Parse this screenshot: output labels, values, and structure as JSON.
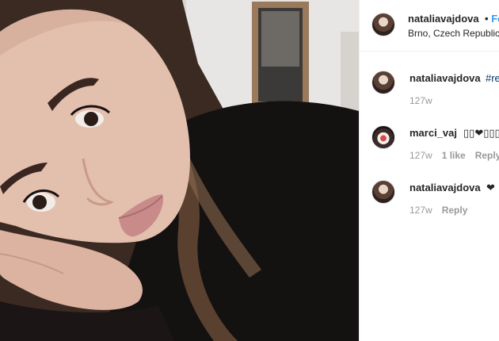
{
  "header": {
    "username": "nataliavajdova",
    "separator": "•",
    "follow_label": "Fo",
    "location": "Brno, Czech Republic"
  },
  "comments": [
    {
      "username": "nataliavajdova",
      "text": "#re",
      "time": "127w",
      "likes": "",
      "reply": ""
    },
    {
      "username": "marci_vaj",
      "text": "❤",
      "time": "127w",
      "likes": "1 like",
      "reply": "Reply"
    },
    {
      "username": "nataliavajdova",
      "text": "❤",
      "time": "127w",
      "likes": "",
      "reply": "Reply"
    }
  ],
  "icons": [
    "avatar-nataliavajdova",
    "avatar-marci-vaj"
  ],
  "colors": {
    "link": "#3897f0",
    "hashtag": "#003569",
    "meta": "#999999",
    "border": "#efefef"
  }
}
